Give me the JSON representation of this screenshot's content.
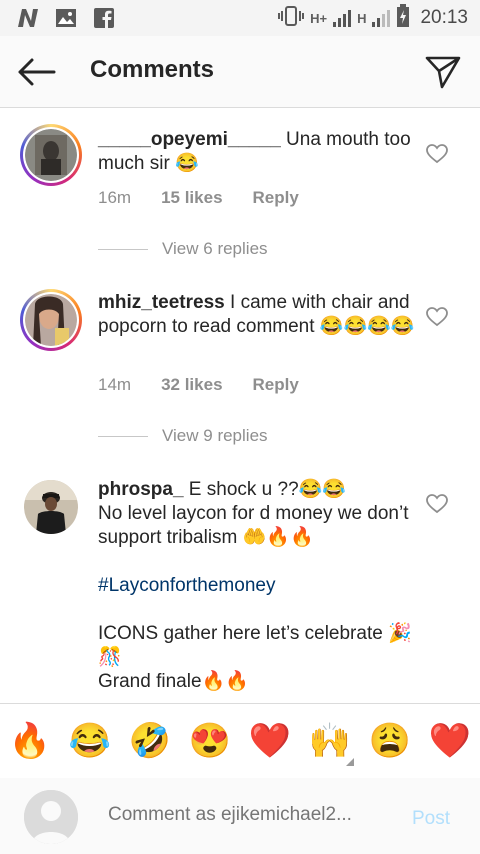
{
  "status_bar": {
    "time": "20:13",
    "network_1": "H+",
    "network_2": "H",
    "left_icons": [
      "n-logo-icon",
      "gallery-icon",
      "facebook-icon"
    ],
    "right_icons": [
      "vibrate-icon",
      "signal-icon",
      "signal-icon",
      "battery-charging-icon"
    ]
  },
  "header": {
    "title": "Comments",
    "back_icon": "arrow-left-icon",
    "send_icon": "paper-plane-icon"
  },
  "comments": [
    {
      "username": "_____opeyemi_____",
      "text": " Una mouth too much sir 😂",
      "time": "16m",
      "likes": "15 likes",
      "reply": "Reply",
      "view_replies": "View 6 replies"
    },
    {
      "username": "mhiz_teetress",
      "text": " I came with chair and popcorn to read comment 😂😂😂😂",
      "time": "14m",
      "likes": "32 likes",
      "reply": "Reply",
      "view_replies": "View 9 replies"
    },
    {
      "username": "phrospa_",
      "line1": " E shock u ??😂😂",
      "line2": "No level laycon for d money we don’t support tribalism 🤲🔥🔥",
      "hashtag": "#Layconforthemoney",
      "line3": "ICONS gather here let’s celebrate 🎉 🎊",
      "line4": "Grand finale🔥🔥"
    }
  ],
  "emoji_bar": [
    "🔥",
    "😂",
    "🤣",
    "😍",
    "❤️",
    "🙌",
    "😩",
    "❤️"
  ],
  "composer": {
    "placeholder": "Comment as ejikemichael2...",
    "post_label": "Post"
  }
}
